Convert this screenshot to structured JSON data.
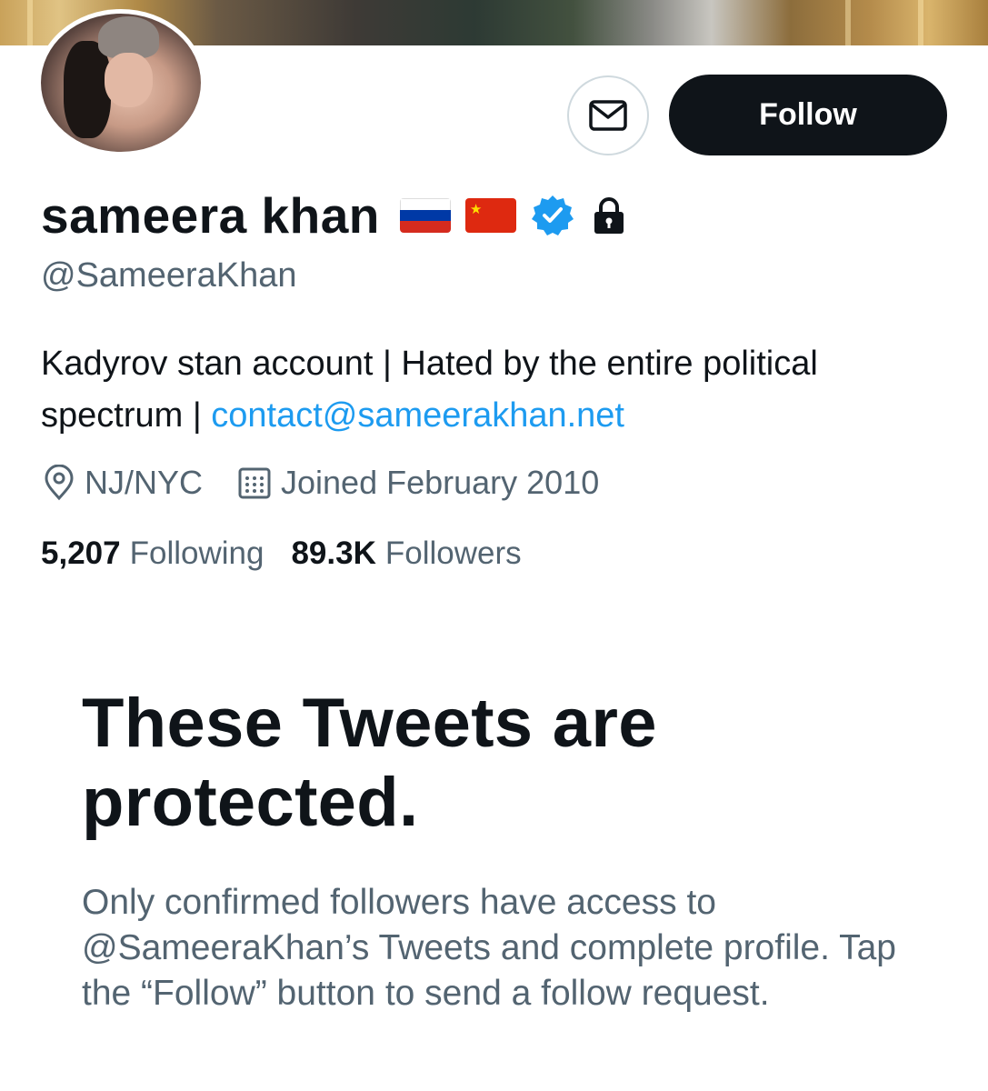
{
  "profile": {
    "display_name": "sameera khan",
    "handle": "@SameeraKhan",
    "bio_text": "Kadyrov stan account | Hated by the entire political spectrum | ",
    "bio_link": "contact@sameerakhan.net",
    "location": "NJ/NYC",
    "joined": "Joined February 2010"
  },
  "actions": {
    "follow_label": "Follow"
  },
  "stats": {
    "following_count": "5,207",
    "following_label": "Following",
    "followers_count": "89.3K",
    "followers_label": "Followers"
  },
  "protected": {
    "title": "These Tweets are protected.",
    "body": "Only confirmed followers have access to @SameeraKhan’s Tweets and complete profile. Tap the “Follow” button to send a follow request."
  },
  "icons": {
    "flag_1": "russia-flag-icon",
    "flag_2": "china-flag-icon",
    "verified": "verified-badge-icon",
    "lock": "lock-icon",
    "message": "mail-icon",
    "location": "location-pin-icon",
    "calendar": "calendar-icon"
  },
  "colors": {
    "link": "#1d9bf0",
    "verified": "#1d9bf0",
    "primary_text": "#0f1419",
    "secondary_text": "#536471",
    "button_bg": "#0f1419"
  }
}
